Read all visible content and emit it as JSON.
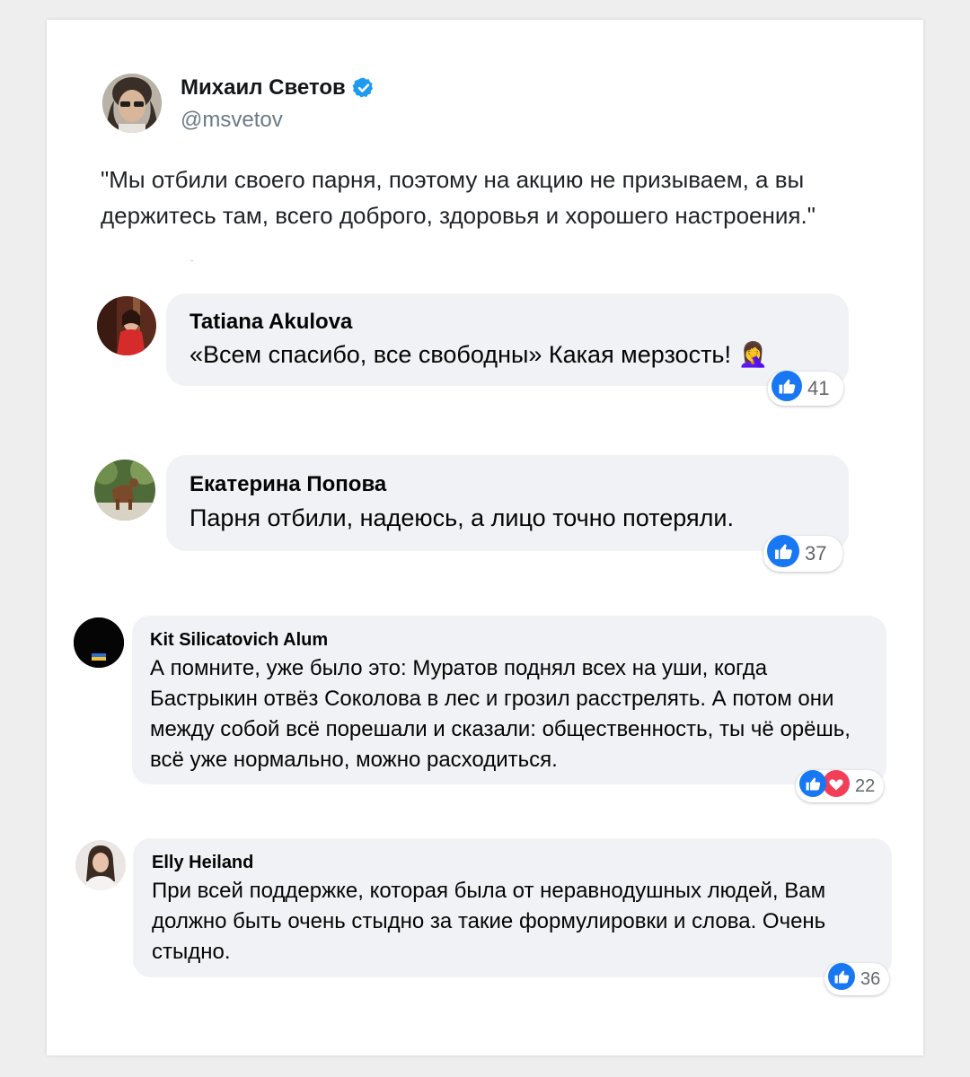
{
  "post": {
    "author_name": "Михаил Светов",
    "handle": "@msvetov",
    "text": "\"Мы отбили своего парня, поэтому на акцию не призываем, а вы держитесь там, всего доброго, здоровья и хорошего настроения.\""
  },
  "comments": [
    {
      "name": "Tatiana Akulova",
      "text": "«Всем спасибо, все свободны» Какая мерзость! 🤦‍♀️",
      "likes": "41"
    },
    {
      "name": "Екатерина Попова",
      "text": "Парня отбили, надеюсь, а лицо точно потеряли.",
      "likes": "37"
    },
    {
      "name": "Kit Silicatovich Alum",
      "text": "А помните, уже было это: Муратов поднял всех на уши, когда Бастрыкин отвёз Соколова в лес и грозил расстрелять. А потом они между собой всё порешали и сказали: общественность, ты чё орёшь, всё уже нормально, можно расходиться.",
      "likes": "22"
    },
    {
      "name": "Elly Heiland",
      "text": "При всей поддержке, которая была от неравнодушных людей, Вам должно быть очень стыдно за такие формулировки и слова. Очень стыдно.",
      "likes": "36"
    }
  ],
  "icons": {
    "verified": "verified-badge-icon",
    "like": "like-thumb-icon",
    "love": "love-heart-icon"
  },
  "colors": {
    "verified": "#1d9bf0",
    "like": "#1877f2",
    "love": "#f33e58",
    "bubble": "#f0f2f5"
  }
}
